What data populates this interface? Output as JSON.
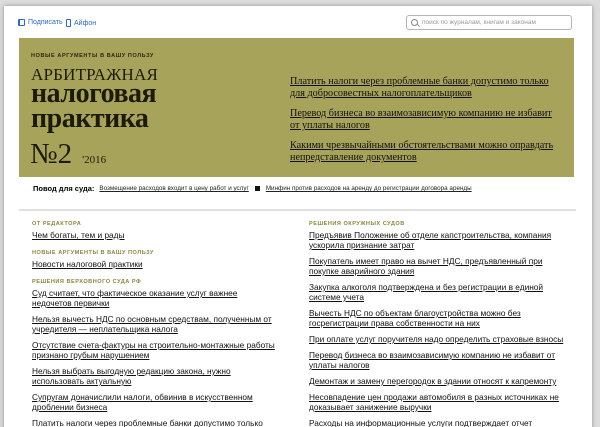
{
  "toolbar": {
    "subscribe_label": "Подписать",
    "iphone_label": "Айфон",
    "search_placeholder": "поиск по журналам, книгам и законам"
  },
  "banner": {
    "eyebrow": "НОВЫЕ АРГУМЕНТЫ В ВАШУ ПОЛЬЗУ",
    "title_line1": "АРБИТРАЖНАЯ",
    "title_line2": "налоговая",
    "title_line3": "практика",
    "issue_number": "№2",
    "issue_year": "'2016",
    "features": [
      "Платить налоги через проблемные банки допустимо только для добросовестных налогоплательщиков",
      "Перевод бизнеса во взаимозависимую компанию не избавит от уплаты налогов",
      "Какими чрезвычайными обстоятельствами можно оправдать непредставление документов"
    ]
  },
  "reason": {
    "label": "Повод для суда:",
    "links": [
      "Возмещение расходов входит в цену работ и услуг",
      "Минфин против расходов на аренду до регистрации договора аренды"
    ]
  },
  "left_column": {
    "sections": [
      {
        "heading": "ОТ РЕДАКТОРА",
        "items": [
          "Чем богаты, тем и рады"
        ]
      },
      {
        "heading": "НОВЫЕ АРГУМЕНТЫ В ВАШУ ПОЛЬЗУ",
        "items": [
          "Новости налоговой практики"
        ]
      },
      {
        "heading": "РЕШЕНИЯ ВЕРХОВНОГО СУДА РФ",
        "items": [
          "Суд считает, что фактическое оказание услуг важнее недочетов первички",
          "Нельзя вычесть НДС по основным средствам, полученным от учредителя — неплательщика налога",
          "Отсутствие счета-фактуры на строительно-монтажные работы признано грубым нарушением",
          "Нельзя выбрать выгодную редакцию закона, нужно использовать актуальную",
          "Супругам доначислили налоги, обвинив в искусственном дроблении бизнеса",
          "Платить налоги через проблемные банки допустимо только для добросовестных налогоплательщиков"
        ]
      }
    ]
  },
  "right_column": {
    "heading": "РЕШЕНИЯ ОКРУЖНЫХ СУДОВ",
    "items": [
      "Предъявив Положение об отделе капстроительства, компания ускорила признание затрат",
      "Покупатель имеет право на вычет НДС, предъявленный при покупке аварийного здания",
      "Закупка алкоголя подтверждена и без регистрации в единой системе учета",
      "Вычесть НДС по объектам благоустройства можно без госрегистрации права собственности на них",
      "При оплате услуг поручителя надо определить страховые взносы",
      "Перевод бизнеса во взаимозависимую компанию не избавит от уплаты налогов",
      "Демонтаж и замену перегородок в здании относят к капремонту",
      "Несовпадение цен продажи автомобиля в разных источниках не доказывает занижение выручки",
      "Расходы на информационные услуги подтверждает отчет"
    ]
  }
}
